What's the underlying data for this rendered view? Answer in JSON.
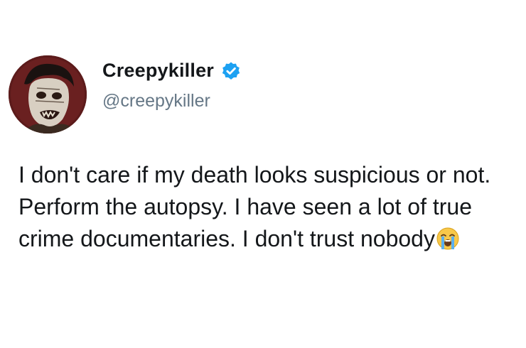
{
  "tweet": {
    "display_name": "Creepykiller",
    "handle": "@creepykiller",
    "text": "I don't care if my death looks suspicious or not. Perform the autopsy. I have seen a lot of true crime documentaries. I don't trust nobody",
    "verified": true,
    "trailing_emoji": "loudly-crying-face-icon"
  },
  "colors": {
    "background": "#ffffff",
    "text": "#14171a",
    "handle": "#657786",
    "verified_badge": "#1da1f2",
    "avatar_bg": "#5a1a1a"
  }
}
